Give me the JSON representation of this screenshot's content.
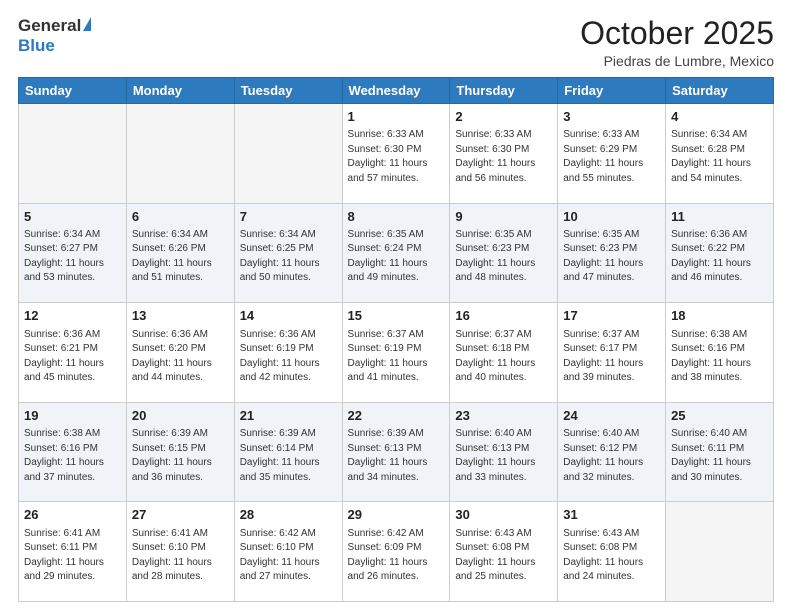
{
  "header": {
    "logo_line1": "General",
    "logo_line2": "Blue",
    "month_title": "October 2025",
    "location": "Piedras de Lumbre, Mexico"
  },
  "weekdays": [
    "Sunday",
    "Monday",
    "Tuesday",
    "Wednesday",
    "Thursday",
    "Friday",
    "Saturday"
  ],
  "weeks": [
    [
      {
        "day": "",
        "detail": ""
      },
      {
        "day": "",
        "detail": ""
      },
      {
        "day": "",
        "detail": ""
      },
      {
        "day": "1",
        "detail": "Sunrise: 6:33 AM\nSunset: 6:30 PM\nDaylight: 11 hours\nand 57 minutes."
      },
      {
        "day": "2",
        "detail": "Sunrise: 6:33 AM\nSunset: 6:30 PM\nDaylight: 11 hours\nand 56 minutes."
      },
      {
        "day": "3",
        "detail": "Sunrise: 6:33 AM\nSunset: 6:29 PM\nDaylight: 11 hours\nand 55 minutes."
      },
      {
        "day": "4",
        "detail": "Sunrise: 6:34 AM\nSunset: 6:28 PM\nDaylight: 11 hours\nand 54 minutes."
      }
    ],
    [
      {
        "day": "5",
        "detail": "Sunrise: 6:34 AM\nSunset: 6:27 PM\nDaylight: 11 hours\nand 53 minutes."
      },
      {
        "day": "6",
        "detail": "Sunrise: 6:34 AM\nSunset: 6:26 PM\nDaylight: 11 hours\nand 51 minutes."
      },
      {
        "day": "7",
        "detail": "Sunrise: 6:34 AM\nSunset: 6:25 PM\nDaylight: 11 hours\nand 50 minutes."
      },
      {
        "day": "8",
        "detail": "Sunrise: 6:35 AM\nSunset: 6:24 PM\nDaylight: 11 hours\nand 49 minutes."
      },
      {
        "day": "9",
        "detail": "Sunrise: 6:35 AM\nSunset: 6:23 PM\nDaylight: 11 hours\nand 48 minutes."
      },
      {
        "day": "10",
        "detail": "Sunrise: 6:35 AM\nSunset: 6:23 PM\nDaylight: 11 hours\nand 47 minutes."
      },
      {
        "day": "11",
        "detail": "Sunrise: 6:36 AM\nSunset: 6:22 PM\nDaylight: 11 hours\nand 46 minutes."
      }
    ],
    [
      {
        "day": "12",
        "detail": "Sunrise: 6:36 AM\nSunset: 6:21 PM\nDaylight: 11 hours\nand 45 minutes."
      },
      {
        "day": "13",
        "detail": "Sunrise: 6:36 AM\nSunset: 6:20 PM\nDaylight: 11 hours\nand 44 minutes."
      },
      {
        "day": "14",
        "detail": "Sunrise: 6:36 AM\nSunset: 6:19 PM\nDaylight: 11 hours\nand 42 minutes."
      },
      {
        "day": "15",
        "detail": "Sunrise: 6:37 AM\nSunset: 6:19 PM\nDaylight: 11 hours\nand 41 minutes."
      },
      {
        "day": "16",
        "detail": "Sunrise: 6:37 AM\nSunset: 6:18 PM\nDaylight: 11 hours\nand 40 minutes."
      },
      {
        "day": "17",
        "detail": "Sunrise: 6:37 AM\nSunset: 6:17 PM\nDaylight: 11 hours\nand 39 minutes."
      },
      {
        "day": "18",
        "detail": "Sunrise: 6:38 AM\nSunset: 6:16 PM\nDaylight: 11 hours\nand 38 minutes."
      }
    ],
    [
      {
        "day": "19",
        "detail": "Sunrise: 6:38 AM\nSunset: 6:16 PM\nDaylight: 11 hours\nand 37 minutes."
      },
      {
        "day": "20",
        "detail": "Sunrise: 6:39 AM\nSunset: 6:15 PM\nDaylight: 11 hours\nand 36 minutes."
      },
      {
        "day": "21",
        "detail": "Sunrise: 6:39 AM\nSunset: 6:14 PM\nDaylight: 11 hours\nand 35 minutes."
      },
      {
        "day": "22",
        "detail": "Sunrise: 6:39 AM\nSunset: 6:13 PM\nDaylight: 11 hours\nand 34 minutes."
      },
      {
        "day": "23",
        "detail": "Sunrise: 6:40 AM\nSunset: 6:13 PM\nDaylight: 11 hours\nand 33 minutes."
      },
      {
        "day": "24",
        "detail": "Sunrise: 6:40 AM\nSunset: 6:12 PM\nDaylight: 11 hours\nand 32 minutes."
      },
      {
        "day": "25",
        "detail": "Sunrise: 6:40 AM\nSunset: 6:11 PM\nDaylight: 11 hours\nand 30 minutes."
      }
    ],
    [
      {
        "day": "26",
        "detail": "Sunrise: 6:41 AM\nSunset: 6:11 PM\nDaylight: 11 hours\nand 29 minutes."
      },
      {
        "day": "27",
        "detail": "Sunrise: 6:41 AM\nSunset: 6:10 PM\nDaylight: 11 hours\nand 28 minutes."
      },
      {
        "day": "28",
        "detail": "Sunrise: 6:42 AM\nSunset: 6:10 PM\nDaylight: 11 hours\nand 27 minutes."
      },
      {
        "day": "29",
        "detail": "Sunrise: 6:42 AM\nSunset: 6:09 PM\nDaylight: 11 hours\nand 26 minutes."
      },
      {
        "day": "30",
        "detail": "Sunrise: 6:43 AM\nSunset: 6:08 PM\nDaylight: 11 hours\nand 25 minutes."
      },
      {
        "day": "31",
        "detail": "Sunrise: 6:43 AM\nSunset: 6:08 PM\nDaylight: 11 hours\nand 24 minutes."
      },
      {
        "day": "",
        "detail": ""
      }
    ]
  ]
}
